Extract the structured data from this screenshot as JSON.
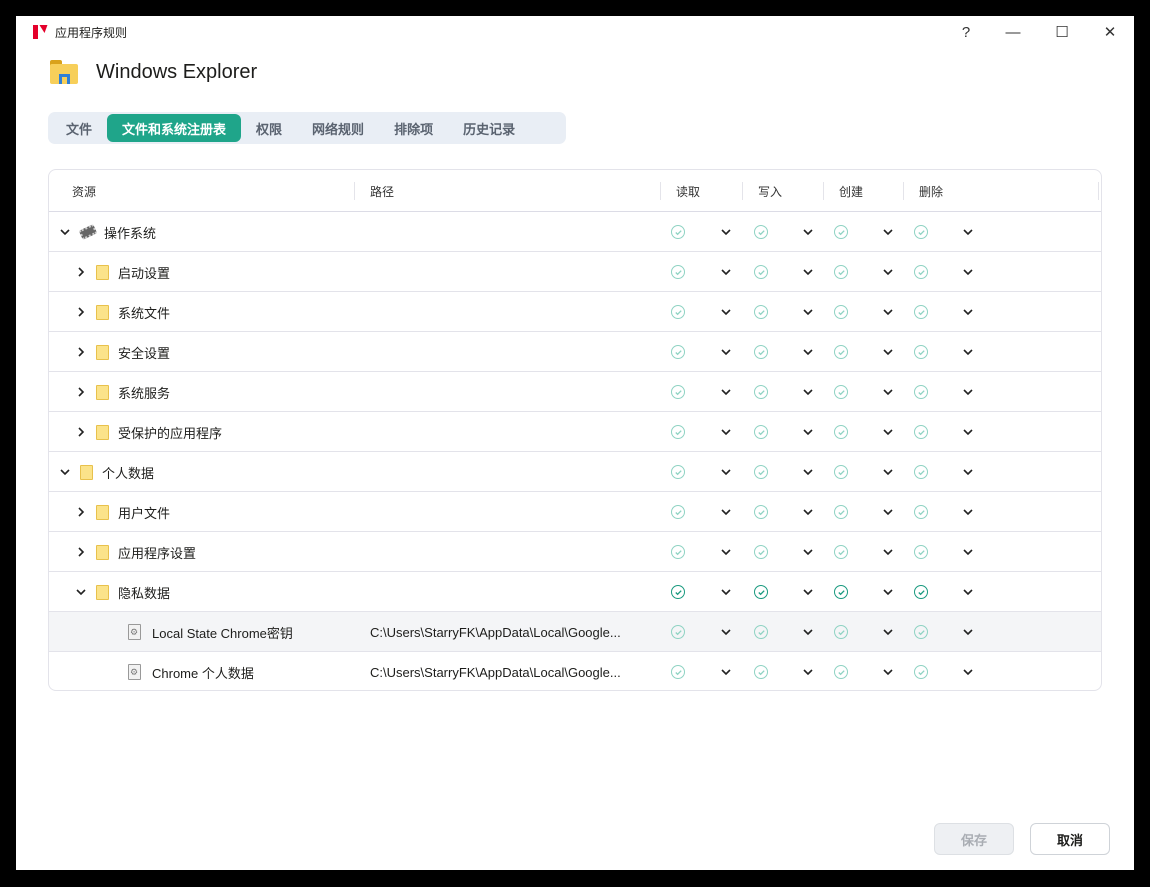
{
  "window": {
    "title": "应用程序规则",
    "help": "?",
    "minimize": "—",
    "maximize": "☐",
    "close": "✕"
  },
  "app": {
    "name": "Windows Explorer"
  },
  "tabs": [
    {
      "label": "文件"
    },
    {
      "label": "文件和系统注册表",
      "active": true
    },
    {
      "label": "权限"
    },
    {
      "label": "网络规则"
    },
    {
      "label": "排除项"
    },
    {
      "label": "历史记录"
    }
  ],
  "columns": {
    "resource": "资源",
    "path": "路径",
    "read": "读取",
    "write": "写入",
    "create": "创建",
    "delete": "删除"
  },
  "rows": [
    {
      "level": 0,
      "expand": "down",
      "icon": "chip",
      "name": "操作系统",
      "path": "",
      "strong": false
    },
    {
      "level": 1,
      "expand": "right",
      "icon": "folder",
      "name": "启动设置",
      "path": "",
      "strong": false
    },
    {
      "level": 1,
      "expand": "right",
      "icon": "folder",
      "name": "系统文件",
      "path": "",
      "strong": false
    },
    {
      "level": 1,
      "expand": "right",
      "icon": "folder",
      "name": "安全设置",
      "path": "",
      "strong": false
    },
    {
      "level": 1,
      "expand": "right",
      "icon": "folder",
      "name": "系统服务",
      "path": "",
      "strong": false
    },
    {
      "level": 1,
      "expand": "right",
      "icon": "folder",
      "name": "受保护的应用程序",
      "path": "",
      "strong": false
    },
    {
      "level": 0,
      "expand": "down",
      "icon": "folder",
      "name": "个人数据",
      "path": "",
      "strong": false
    },
    {
      "level": 1,
      "expand": "right",
      "icon": "folder",
      "name": "用户文件",
      "path": "",
      "strong": false
    },
    {
      "level": 1,
      "expand": "right",
      "icon": "folder",
      "name": "应用程序设置",
      "path": "",
      "strong": false
    },
    {
      "level": 1,
      "expand": "down",
      "icon": "folder",
      "name": "隐私数据",
      "path": "",
      "strong": true
    },
    {
      "level": 2,
      "expand": "",
      "icon": "file",
      "name": "Local State Chrome密钥",
      "path": "C:\\Users\\StarryFK\\AppData\\Local\\Google...",
      "strong": false,
      "highlight": true
    },
    {
      "level": 2,
      "expand": "",
      "icon": "file",
      "name": "Chrome 个人数据",
      "path": "C:\\Users\\StarryFK\\AppData\\Local\\Google...",
      "strong": false
    }
  ],
  "footer": {
    "save": "保存",
    "cancel": "取消"
  },
  "colors": {
    "accent": "#1fa58a",
    "check_light": "#8fd3c3",
    "check_strong": "#1a9a7f"
  }
}
